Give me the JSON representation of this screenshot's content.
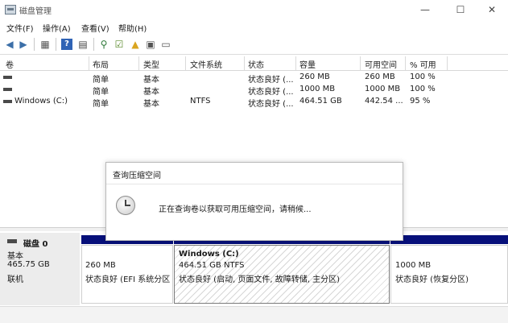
{
  "window": {
    "title": "磁盘管理",
    "minimize": "—",
    "maximize": "☐",
    "close": "✕"
  },
  "menu": [
    "文件(F)",
    "操作(A)",
    "查看(V)",
    "帮助(H)"
  ],
  "toolbar_icons": [
    "back-icon",
    "forward-icon",
    "show-list-icon",
    "help-icon",
    "properties-icon",
    "disk-icon",
    "check-icon",
    "folder-up-icon",
    "settings-icon"
  ],
  "list": {
    "headers": [
      "卷",
      "布局",
      "类型",
      "文件系统",
      "状态",
      "容量",
      "可用空间",
      "% 可用"
    ],
    "rows": [
      {
        "vol": "",
        "layout": "简单",
        "type": "基本",
        "fs": "",
        "status": "状态良好 (...",
        "capacity": "260 MB",
        "free": "260 MB",
        "pct": "100 %"
      },
      {
        "vol": "",
        "layout": "简单",
        "type": "基本",
        "fs": "",
        "status": "状态良好 (...",
        "capacity": "1000 MB",
        "free": "1000 MB",
        "pct": "100 %"
      },
      {
        "vol": "Windows (C:)",
        "layout": "简单",
        "type": "基本",
        "fs": "NTFS",
        "status": "状态良好 (...",
        "capacity": "464.51 GB",
        "free": "442.54 ...",
        "pct": "95 %"
      }
    ]
  },
  "dialog": {
    "title": "查询压缩空间",
    "message": "正在查询卷以获取可用压缩空间，请稍候..."
  },
  "disk": {
    "name": "磁盘 0",
    "type": "基本",
    "size": "465.75 GB",
    "state": "联机",
    "partitions": [
      {
        "size": "260 MB",
        "status": "状态良好 (EFI 系统分区"
      },
      {
        "name": "Windows  (C:)",
        "size": "464.51 GB NTFS",
        "status": "状态良好 (启动, 页面文件, 故障转储, 主分区)"
      },
      {
        "size": "1000 MB",
        "status": "状态良好 (恢复分区)"
      }
    ]
  },
  "colors": {
    "partition_header": "#07107a",
    "hatch": "#d7d7d7"
  }
}
